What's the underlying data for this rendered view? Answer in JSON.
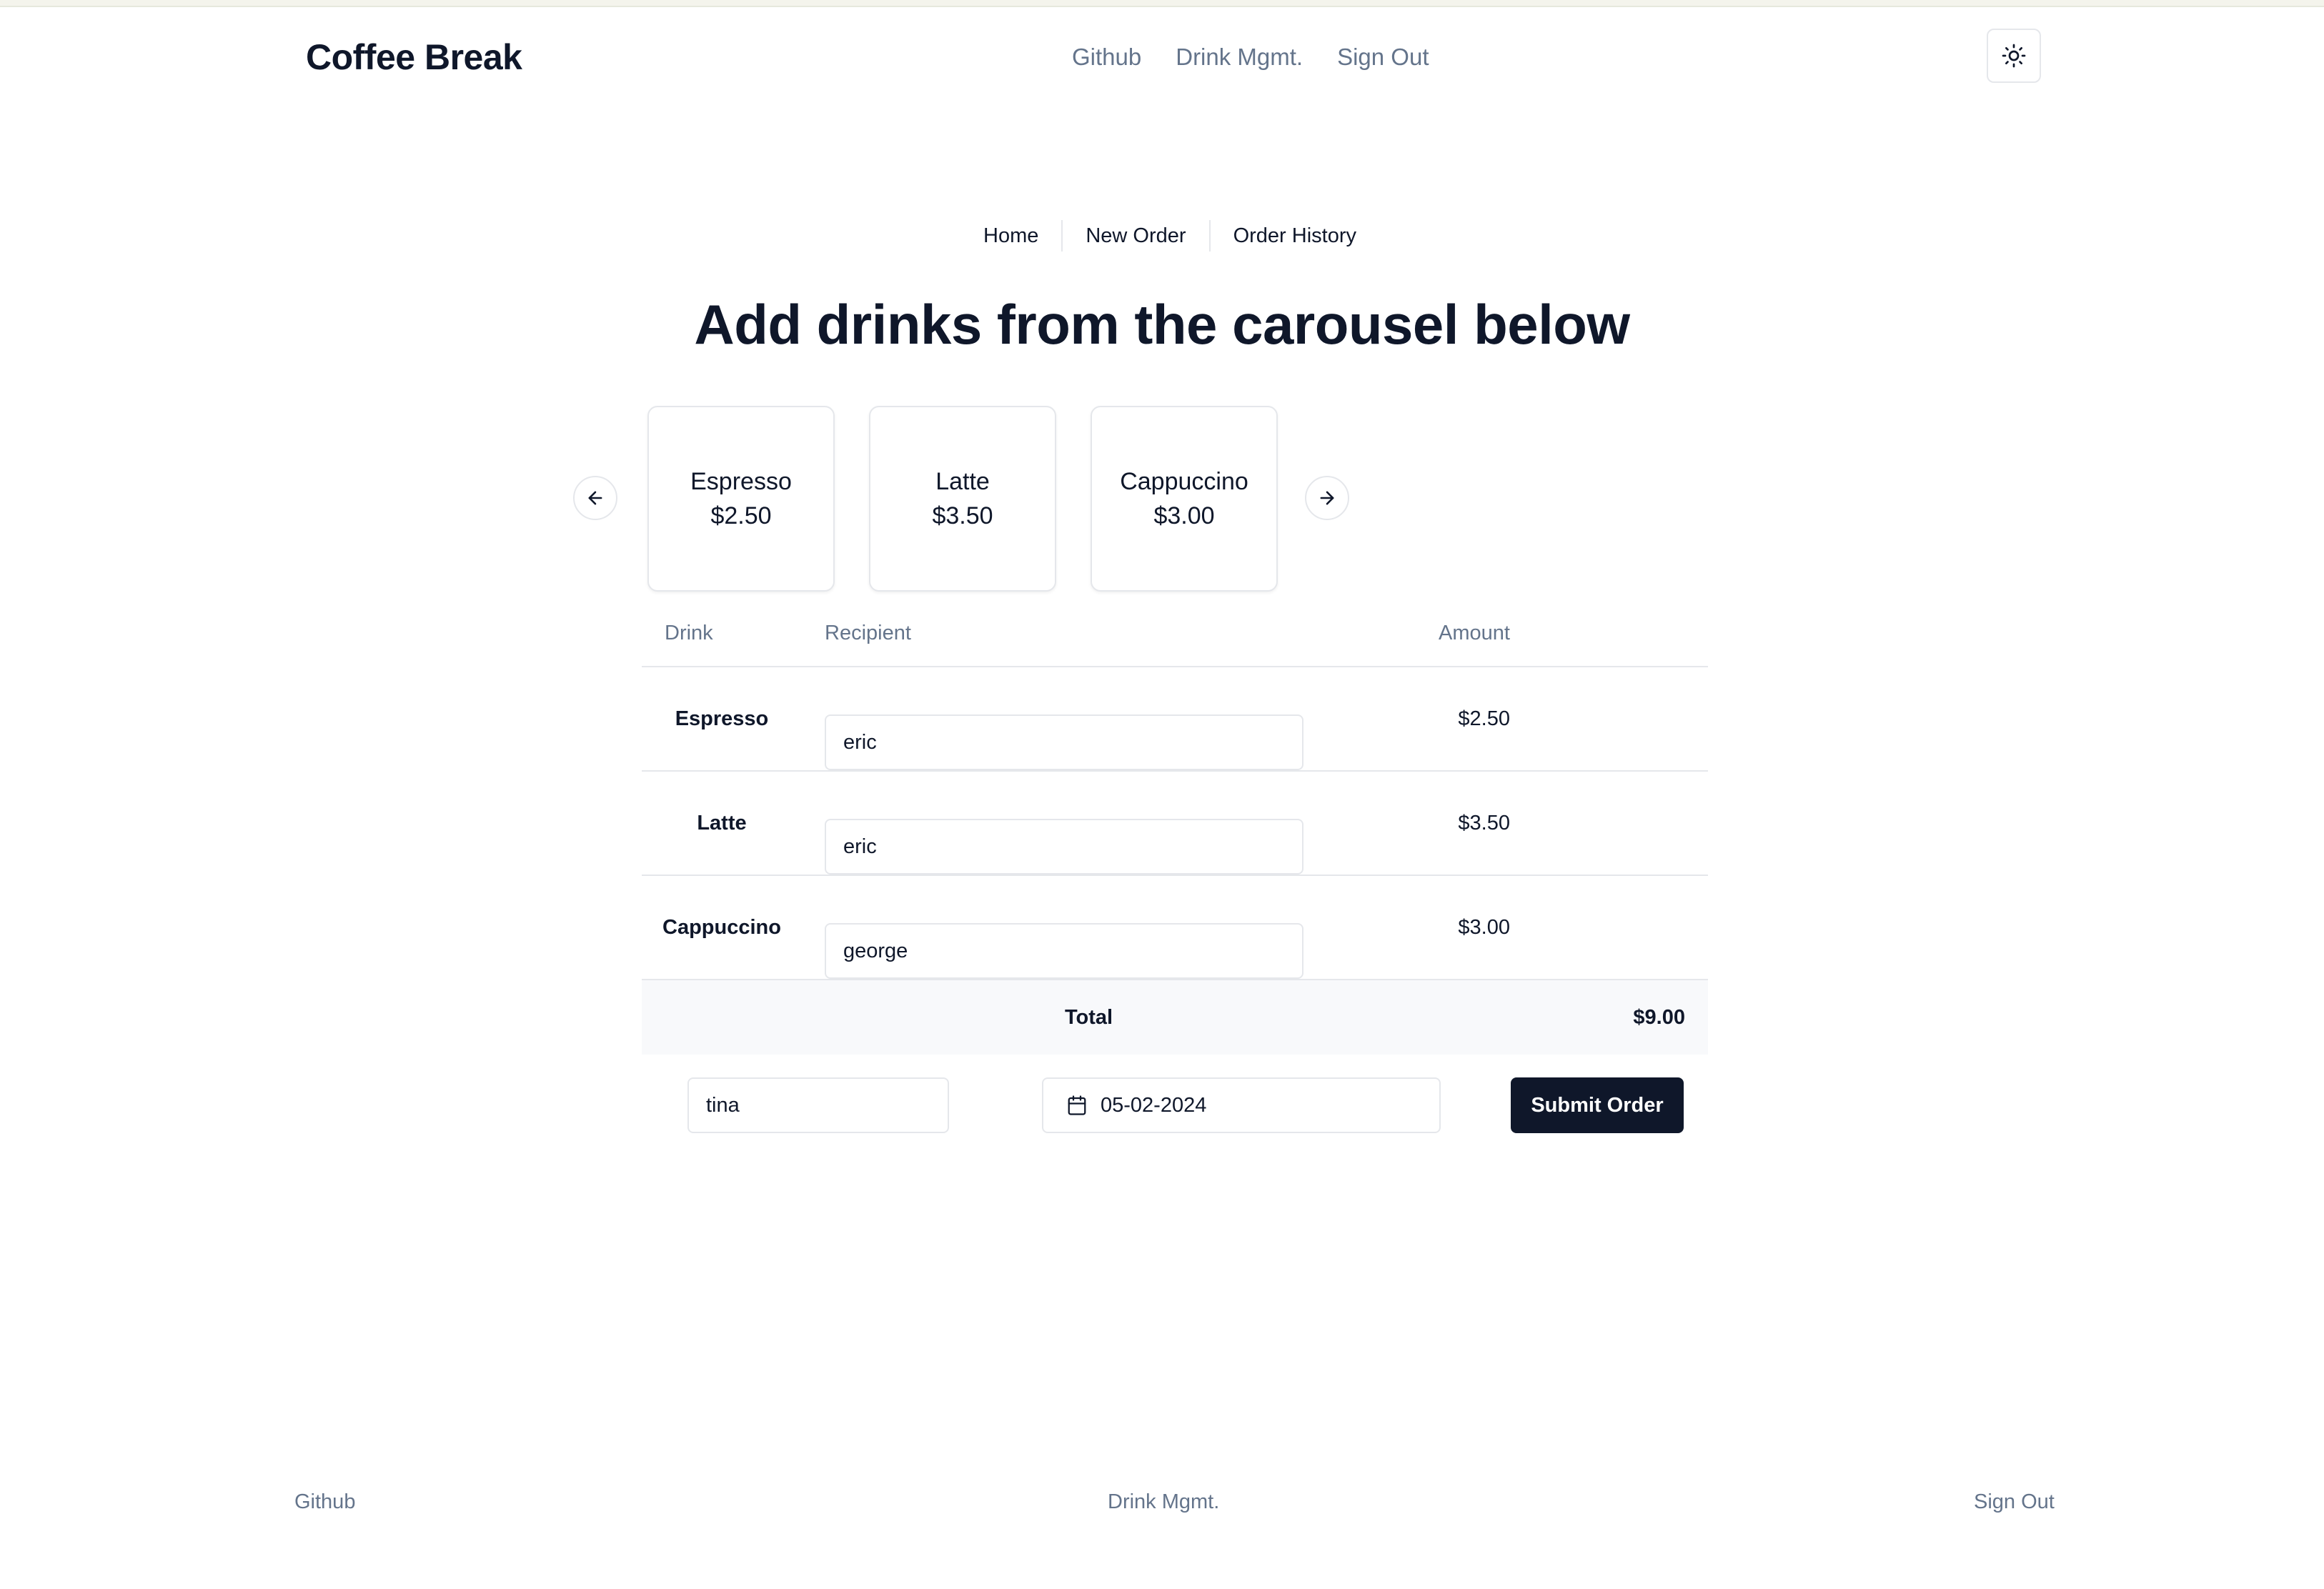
{
  "header": {
    "brand": "Coffee Break",
    "nav": [
      "Github",
      "Drink Mgmt.",
      "Sign Out"
    ],
    "theme_icon": "sun-icon"
  },
  "subnav": [
    "Home",
    "New Order",
    "Order History"
  ],
  "heading": "Add drinks from the carousel below",
  "carousel": {
    "prev_icon": "arrow-left-icon",
    "next_icon": "arrow-right-icon",
    "cards": [
      {
        "name": "Espresso",
        "price": "$2.50"
      },
      {
        "name": "Latte",
        "price": "$3.50"
      },
      {
        "name": "Cappuccino",
        "price": "$3.00"
      }
    ]
  },
  "table": {
    "columns": [
      "Drink",
      "Recipient",
      "Amount"
    ],
    "rows": [
      {
        "drink": "Espresso",
        "recipient": "eric",
        "amount": "$2.50"
      },
      {
        "drink": "Latte",
        "recipient": "eric",
        "amount": "$3.50"
      },
      {
        "drink": "Cappuccino",
        "recipient": "george",
        "amount": "$3.00"
      }
    ],
    "total_label": "Total",
    "total_value": "$9.00"
  },
  "order": {
    "orderer": "tina",
    "date": "05-02-2024",
    "date_icon": "calendar-icon",
    "submit_label": "Submit Order"
  },
  "footer": [
    "Github",
    "Drink Mgmt.",
    "Sign Out"
  ]
}
